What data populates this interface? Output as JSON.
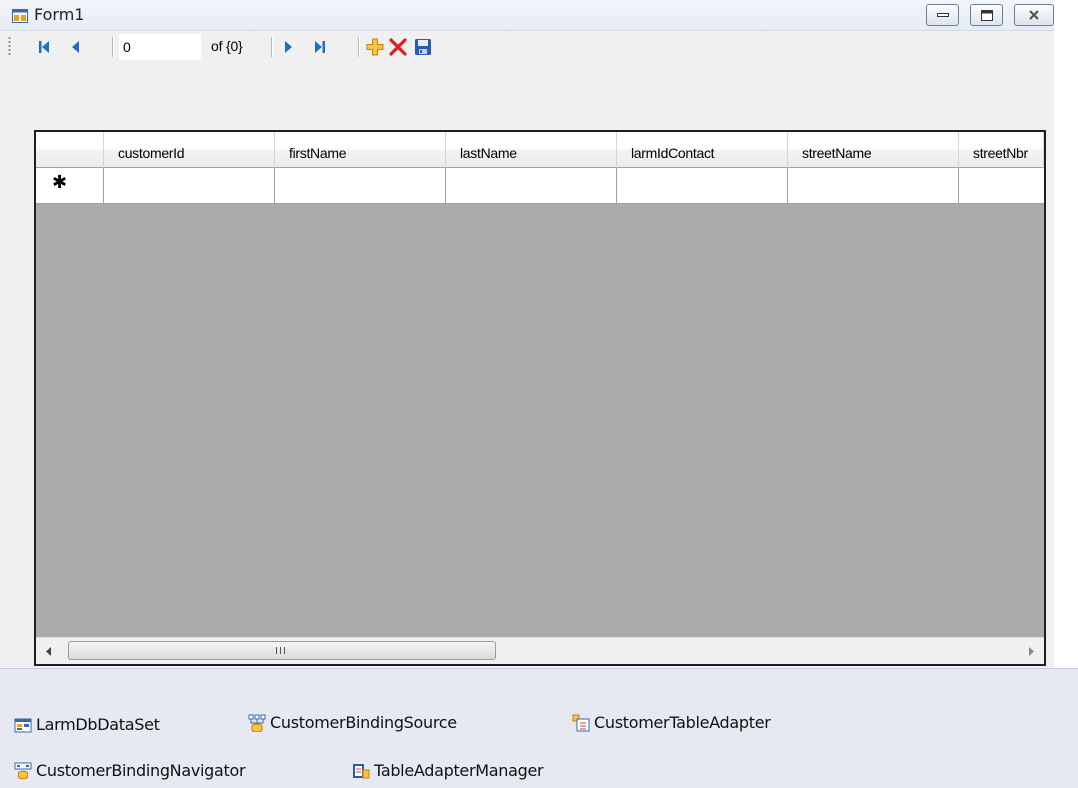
{
  "window": {
    "title": "Form1"
  },
  "navigator": {
    "position_value": "0",
    "count_label": "of {0}"
  },
  "grid": {
    "columns": [
      "customerId",
      "firstName",
      "lastName",
      "larmIdContact",
      "streetName",
      "streetNbr"
    ],
    "new_row_marker": "✱"
  },
  "tray": {
    "items": [
      "LarmDbDataSet",
      "CustomerBindingSource",
      "CustomerTableAdapter",
      "CustomerBindingNavigator",
      "TableAdapterManager"
    ]
  },
  "colors": {
    "grid_background": "#ababab",
    "tray_background": "#e6e9f1",
    "navigate_arrow": "#1f6fc4",
    "delete_red": "#e21b1b",
    "add_yellow": "#f2b233"
  }
}
